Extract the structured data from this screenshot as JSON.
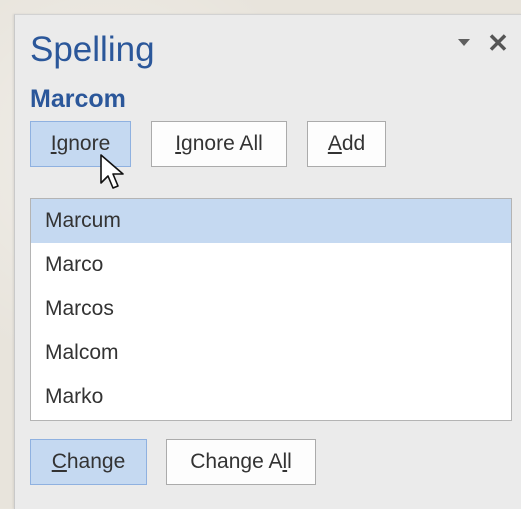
{
  "pane": {
    "title": "Spelling",
    "misspelled_word": "Marcom"
  },
  "buttons": {
    "ignore": {
      "pre": "",
      "acc": "I",
      "post": "gnore"
    },
    "ignore_all": {
      "pre": "",
      "acc": "I",
      "post": "gnore All"
    },
    "add": {
      "pre": "",
      "acc": "A",
      "post": "dd"
    },
    "change": {
      "pre": "",
      "acc": "C",
      "post": "hange"
    },
    "change_all": {
      "pre": "Change A",
      "acc": "l",
      "post": "l"
    }
  },
  "suggestions": [
    {
      "word": "Marcum",
      "selected": true
    },
    {
      "word": "Marco",
      "selected": false
    },
    {
      "word": "Marcos",
      "selected": false
    },
    {
      "word": "Malcom",
      "selected": false
    },
    {
      "word": "Marko",
      "selected": false
    }
  ],
  "icons": {
    "options": "chevron-down-icon",
    "close": "close-icon",
    "pointer": "mouse-pointer-icon"
  },
  "colors": {
    "accent": "#2b579a",
    "selection": "#c5d9f1",
    "pane_background": "#ebebeb"
  }
}
